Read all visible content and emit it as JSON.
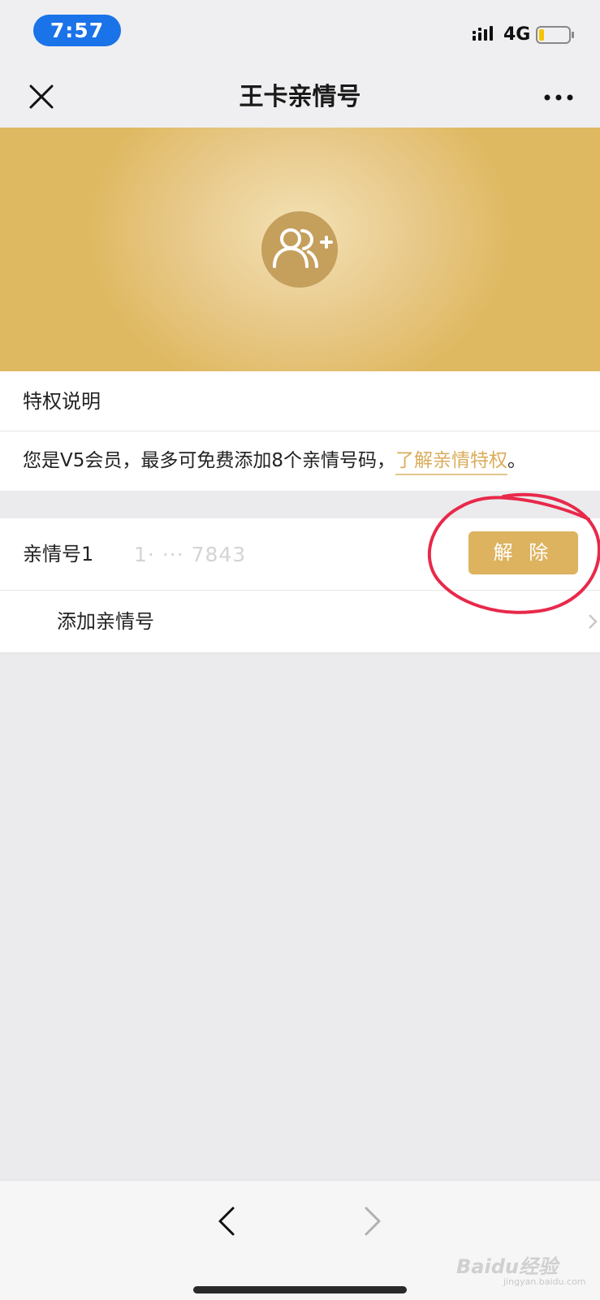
{
  "status_bar": {
    "time": "7:57",
    "network": "4G",
    "icons": [
      "signal-icon",
      "battery-icon"
    ]
  },
  "nav": {
    "title": "王卡亲情号",
    "left_icon": "close-icon",
    "right_icon": "more-icon"
  },
  "banner": {
    "icon": "add-family-icon",
    "color": "#ddb35f"
  },
  "privilege": {
    "title": "特权说明",
    "desc_prefix": "您是V5会员，最多可免费添加8个亲情号码，",
    "desc_link": "了解亲情特权",
    "desc_suffix": "。"
  },
  "family_list": {
    "items": [
      {
        "label": "亲情号1",
        "number": "1· ··· 7843",
        "action": "解 除"
      }
    ],
    "add_label": "添加亲情号"
  },
  "annotation": {
    "color": "#e8294a"
  },
  "bottom": {
    "icons": [
      "back-icon",
      "forward-icon"
    ],
    "watermark": "Baidu经验",
    "watermark_sub": "jingyan.baidu.com"
  }
}
